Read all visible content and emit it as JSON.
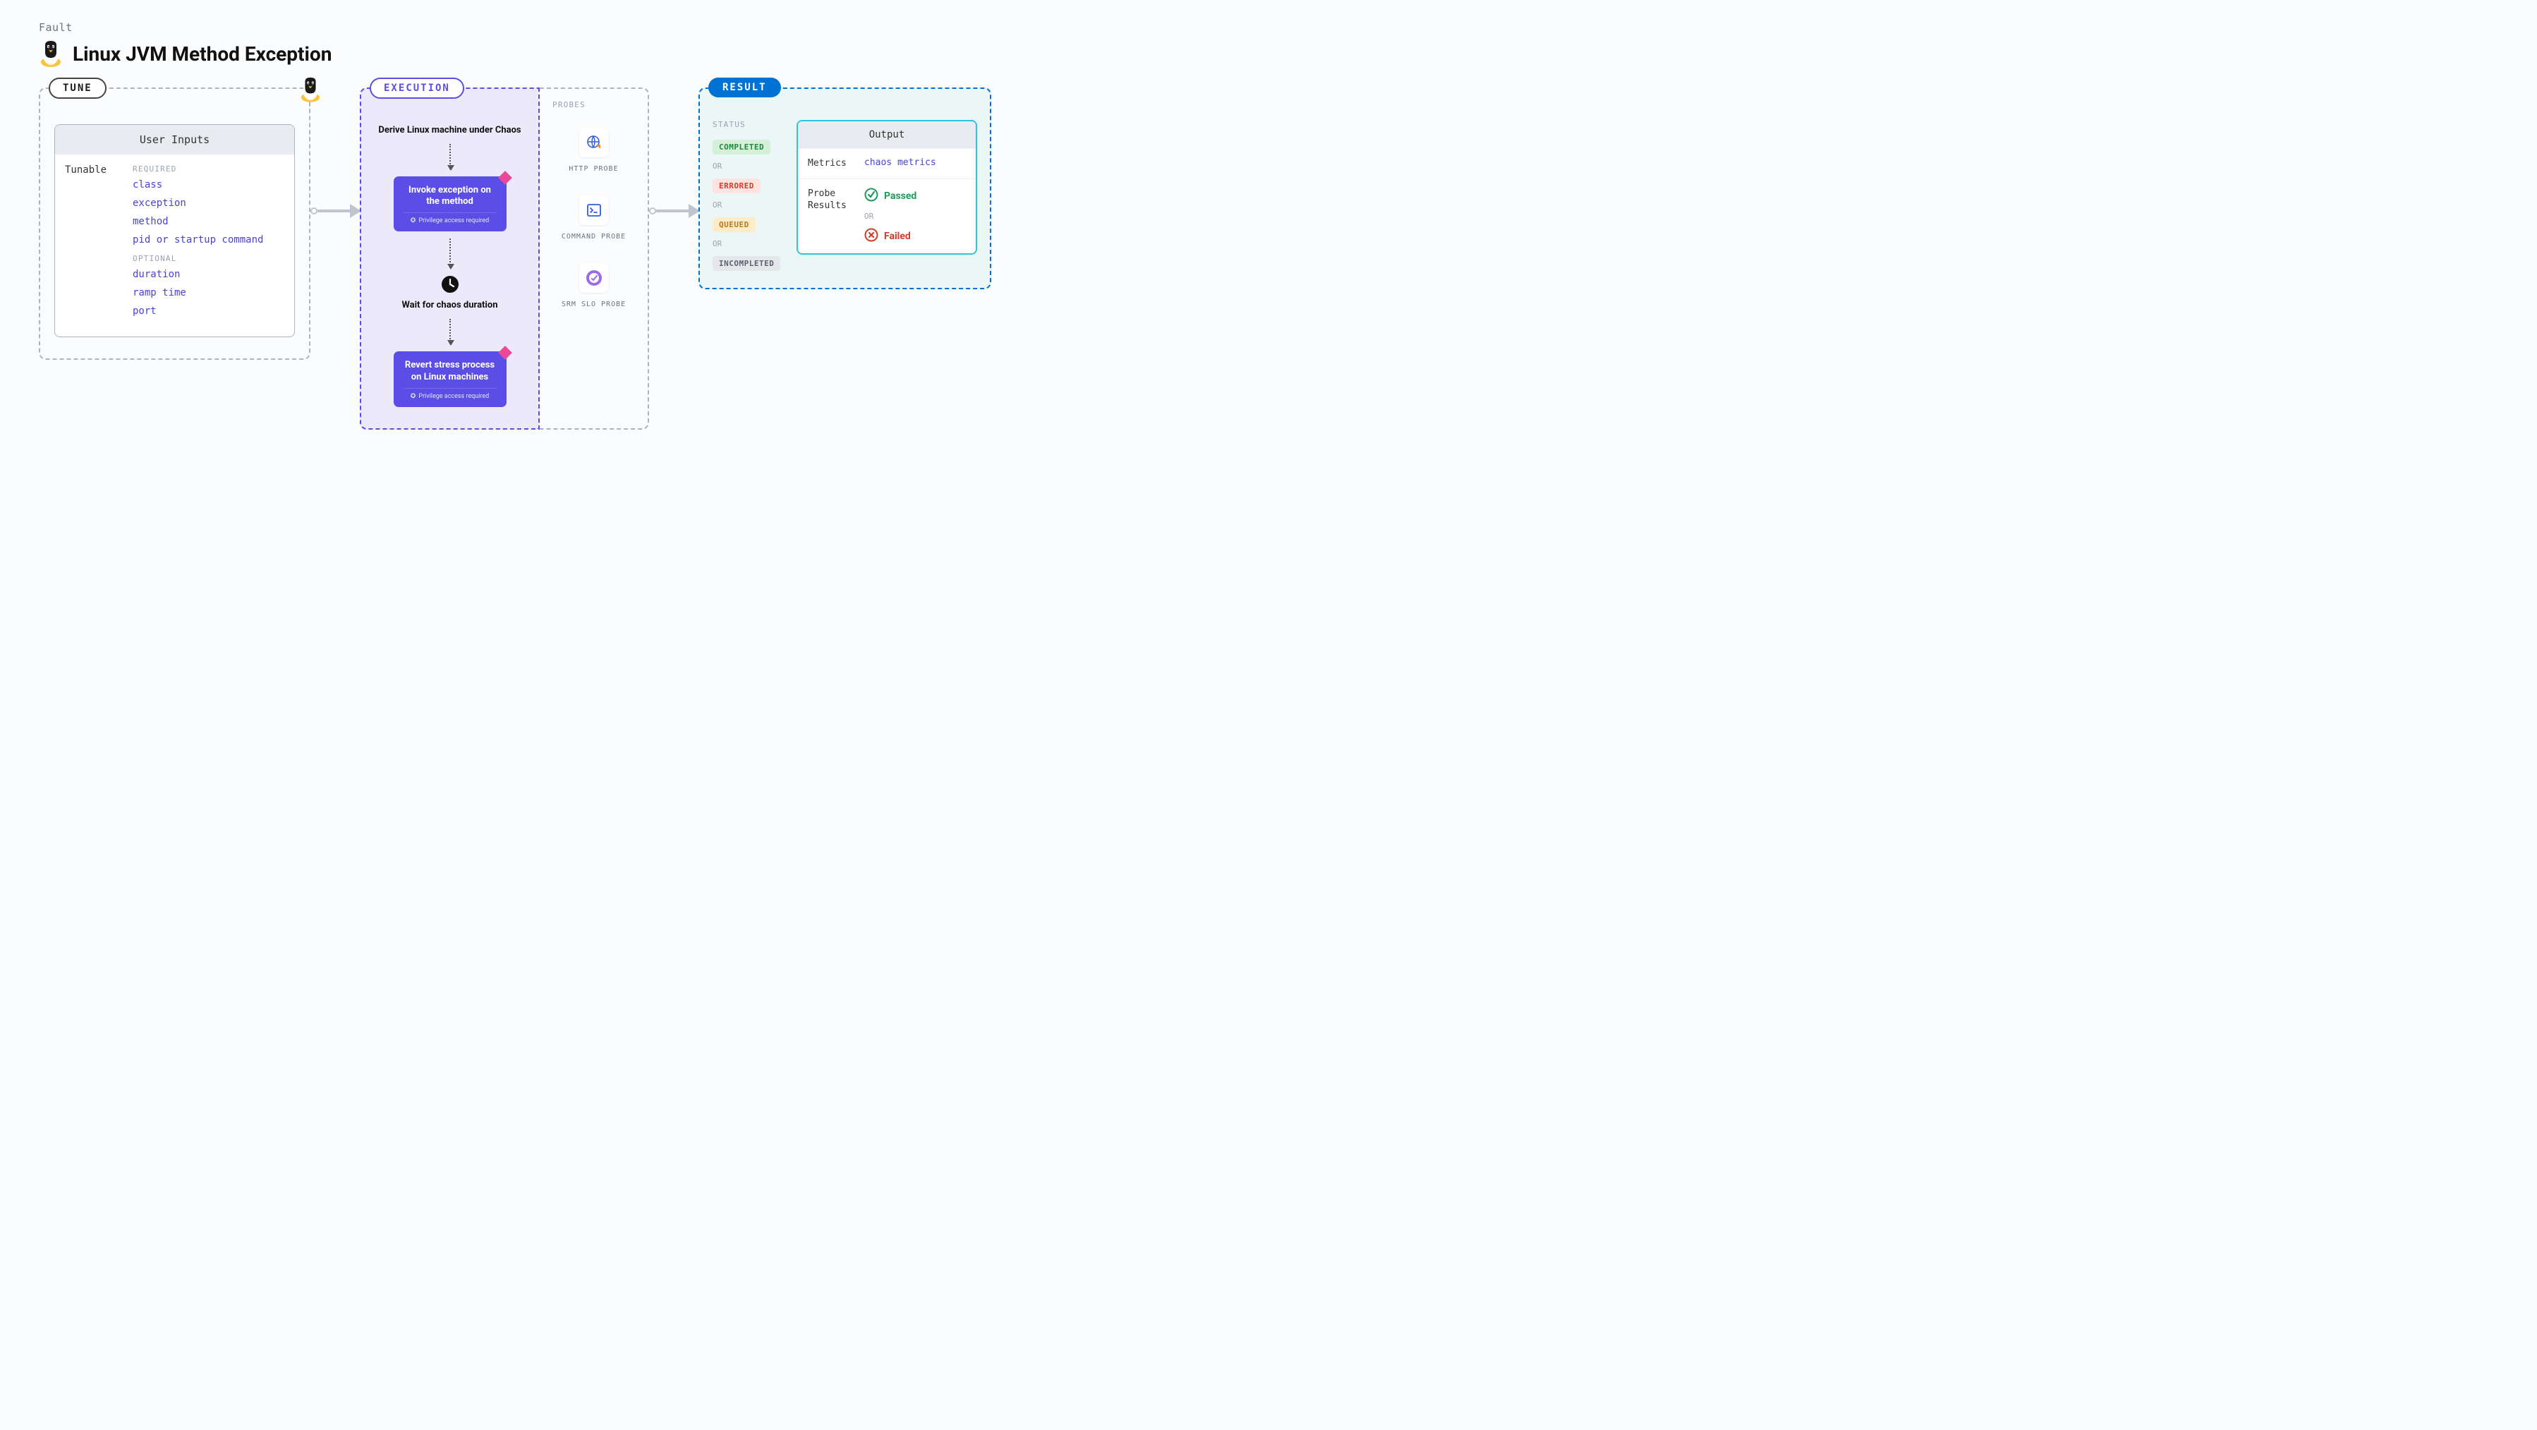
{
  "header": {
    "category": "Fault",
    "title": "Linux JVM Method Exception"
  },
  "tune": {
    "badge": "TUNE",
    "card_title": "User Inputs",
    "tunable_label": "Tunable",
    "required_label": "REQUIRED",
    "optional_label": "OPTIONAL",
    "required": [
      "class",
      "exception",
      "method",
      "pid or startup command"
    ],
    "optional": [
      "duration",
      "ramp time",
      "port"
    ]
  },
  "execution": {
    "badge": "EXECUTION",
    "step1": "Derive Linux machine under Chaos",
    "card1_title": "Invoke exception on the method",
    "privilege_note": "Privilege access required",
    "wait_step": "Wait for chaos duration",
    "card2_title": "Revert stress process on Linux machines"
  },
  "probes": {
    "title": "PROBES",
    "items": [
      "HTTP PROBE",
      "COMMAND PROBE",
      "SRM SLO PROBE"
    ]
  },
  "result": {
    "badge": "RESULT",
    "status_title": "STATUS",
    "or": "OR",
    "statuses": {
      "completed": "COMPLETED",
      "errored": "ERRORED",
      "queued": "QUEUED",
      "incompleted": "INCOMPLETED"
    },
    "output_title": "Output",
    "metrics_key": "Metrics",
    "metrics_val": "chaos metrics",
    "probe_results_key": "Probe Results",
    "passed": "Passed",
    "failed": "Failed"
  }
}
